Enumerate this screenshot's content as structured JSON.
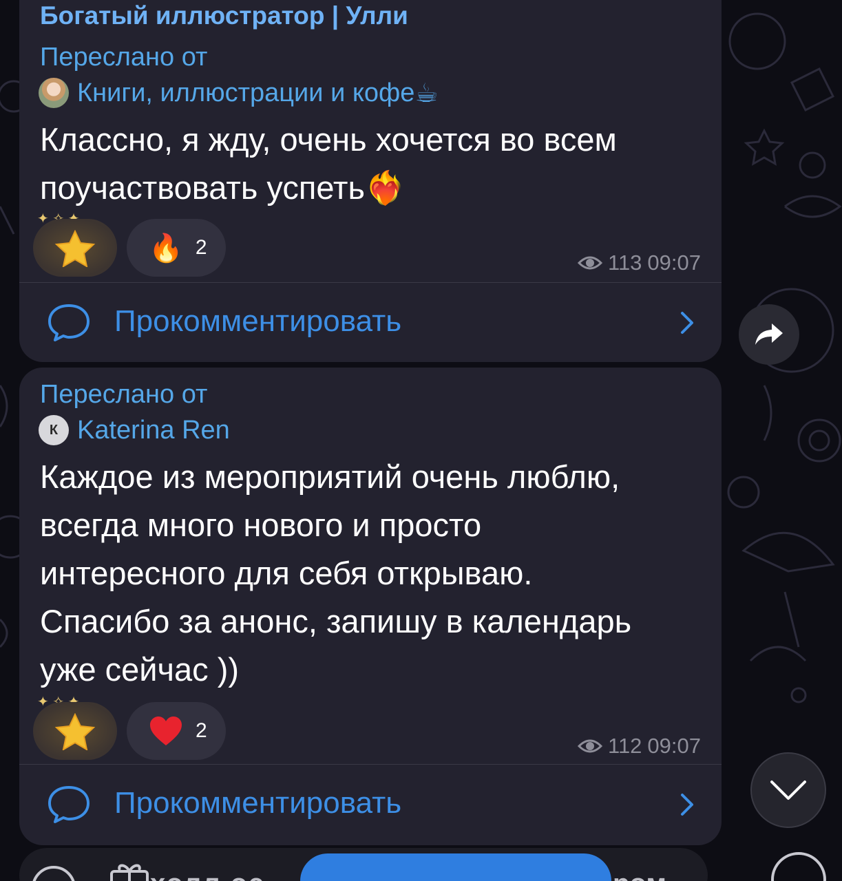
{
  "colors": {
    "background": "#0d0d14",
    "bubble": "#23222f",
    "accent_blue": "#3d8fe6",
    "channel_name": "#6fb2f5",
    "meta_gray": "#8e8e99"
  },
  "messages": [
    {
      "channel_name": "Богатый иллюстратор | Улли",
      "forwarded_label": "Переслано от",
      "forwarded_from": "Книги, иллюстрации и кофе",
      "forwarded_from_emoji": "☕",
      "avatar_type": "photo-icon",
      "text_lines": [
        "Классно, я жду, очень хочется во всем",
        "поучаствовать успеть"
      ],
      "text_emoji": "❤️‍🔥",
      "reactions": [
        {
          "icon": "star-icon",
          "count": ""
        },
        {
          "icon": "fire-icon",
          "emoji": "🔥",
          "count": "2"
        }
      ],
      "views": "113",
      "time": "09:07",
      "comment_label": "Прокомментировать"
    },
    {
      "forwarded_label": "Переслано от",
      "forwarded_from": "Katerina Ren",
      "avatar_letter": "К",
      "text_lines": [
        "Каждое из мероприятий очень люблю,",
        "всегда много нового и просто",
        "интересного для себя открываю.",
        "Спасибо за анонс, запишу в календарь",
        "уже сейчас ))"
      ],
      "reactions": [
        {
          "icon": "star-icon",
          "count": ""
        },
        {
          "icon": "heart-icon",
          "count": "2"
        }
      ],
      "views": "112",
      "time": "09:07",
      "comment_label": "Прокомментировать"
    }
  ],
  "floating": {
    "share_icon": "share-arrow-icon",
    "scroll_icon": "chevron-down-icon"
  },
  "bottom": {
    "partial_text_left": "холл ос",
    "partial_text_right": "ром"
  }
}
